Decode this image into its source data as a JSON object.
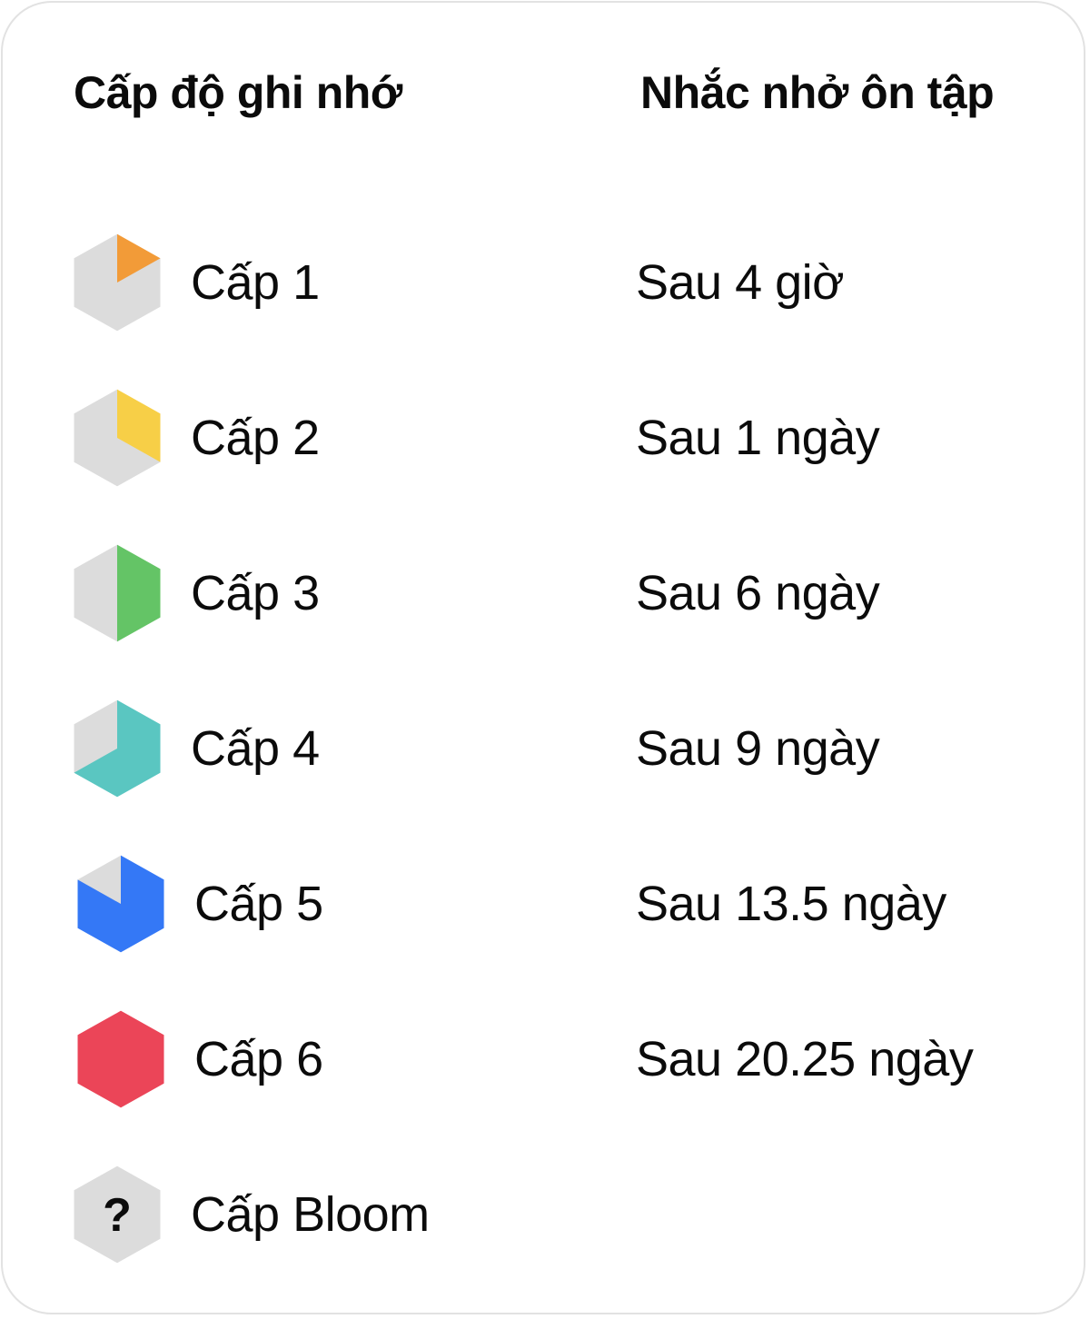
{
  "headers": {
    "level": "Cấp độ ghi nhớ",
    "reminder": "Nhắc nhở ôn tập"
  },
  "colors": {
    "track": "#dcdcdc",
    "text": "#0b0b0b",
    "border": "#e2e2e2"
  },
  "levels": [
    {
      "label": "Cấp 1",
      "reminder": "Sau 4 giờ",
      "progress": 0.1667,
      "color": "#f29b38",
      "icon": "level-1-hexagon-icon"
    },
    {
      "label": "Cấp 2",
      "reminder": "Sau 1 ngày",
      "progress": 0.3333,
      "color": "#f7cf47",
      "icon": "level-2-hexagon-icon"
    },
    {
      "label": "Cấp 3",
      "reminder": "Sau 6 ngày",
      "progress": 0.5,
      "color": "#64c466",
      "icon": "level-3-hexagon-icon"
    },
    {
      "label": "Cấp 4",
      "reminder": "Sau 9 ngày",
      "progress": 0.6667,
      "color": "#5ac6c1",
      "icon": "level-4-hexagon-icon"
    },
    {
      "label": "Cấp 5",
      "reminder": "Sau 13.5 ngày",
      "progress": 0.8333,
      "color": "#3478f6",
      "icon": "level-5-hexagon-icon"
    },
    {
      "label": "Cấp 6",
      "reminder": "Sau 20.25 ngày",
      "progress": 1.0,
      "color": "#eb4558",
      "icon": "level-6-hexagon-icon"
    },
    {
      "label": "Cấp Bloom",
      "reminder": "",
      "progress": 0,
      "color": "#dcdcdc",
      "icon": "question-mark-hexagon-icon",
      "symbol": "?"
    }
  ]
}
